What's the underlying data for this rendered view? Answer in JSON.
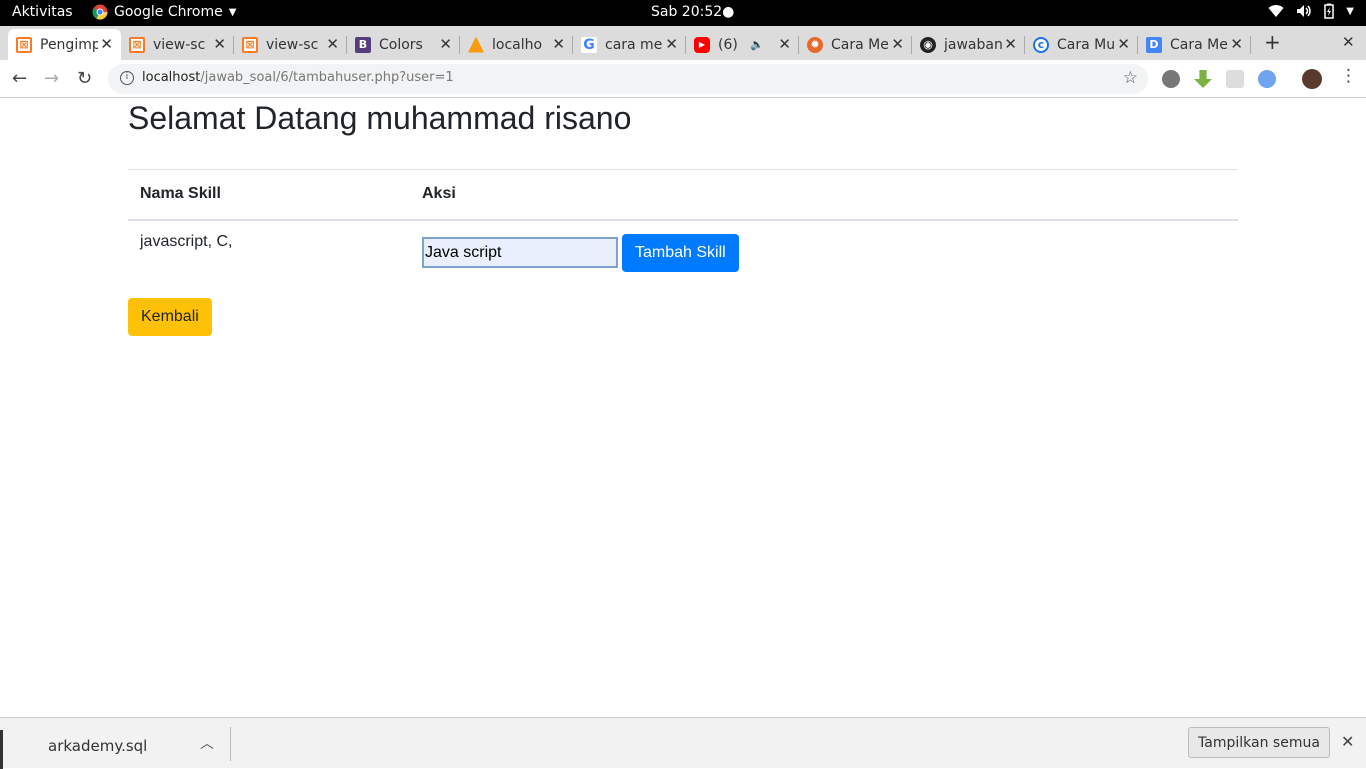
{
  "topbar": {
    "activities": "Aktivitas",
    "app_name": "Google Chrome",
    "clock": "Sab 20:52"
  },
  "tabs": [
    {
      "title": "Pengimp",
      "icon": "xampp-icon",
      "active": true
    },
    {
      "title": "view-sc",
      "icon": "xampp-icon"
    },
    {
      "title": "view-sc",
      "icon": "xampp-icon"
    },
    {
      "title": "Colors",
      "icon": "bootstrap-icon"
    },
    {
      "title": "localho",
      "icon": "phpmyadmin-icon"
    },
    {
      "title": "cara me",
      "icon": "google-icon"
    },
    {
      "title": "(6)",
      "icon": "youtube-icon",
      "audio": true
    },
    {
      "title": "Cara Me",
      "icon": "blog-icon"
    },
    {
      "title": "jawaban",
      "icon": "github-icon"
    },
    {
      "title": "Cara Mu",
      "icon": "site-icon"
    },
    {
      "title": "Cara Me",
      "icon": "d-icon"
    }
  ],
  "address_bar": {
    "host": "localhost",
    "path": "/jawab_soal/6/tambahuser.php?user=1"
  },
  "page": {
    "heading": "Selamat Datang muhammad risano",
    "table": {
      "headers": [
        "Nama Skill",
        "Aksi"
      ],
      "skills_text": "javascript, C,"
    },
    "skill_input_value": "Java script",
    "add_button": "Tambah Skill",
    "back_button": "Kembali"
  },
  "downloads": {
    "file": "arkademy.sql",
    "show_all": "Tampilkan semua"
  },
  "colors": {
    "primary": "#007bff",
    "warning": "#ffc107"
  }
}
